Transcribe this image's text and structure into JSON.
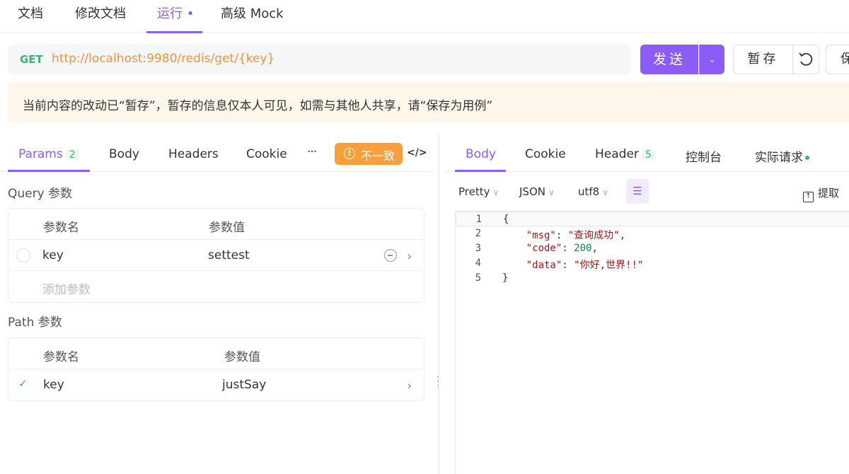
{
  "top_tabs": [
    {
      "label": "文档"
    },
    {
      "label": "修改文档"
    },
    {
      "label": "运行 •"
    },
    {
      "label": "高级 Mock"
    }
  ],
  "request": {
    "method": "GET",
    "url": "http://localhost:9980/redis/get/{key}",
    "send_label": "发送",
    "stash_label": "暂存",
    "save_label": "保"
  },
  "notice": "当前内容的改动已“暂存”，暂存的信息仅本人可见，如需与其他人共享，请“保存为用例”",
  "left_tabs": {
    "params": "Params",
    "params_count": "2",
    "body": "Body",
    "headers": "Headers",
    "cookies": "Cookie",
    "more": "···",
    "mismatch": "不一致",
    "code": "</>"
  },
  "query": {
    "title": "Query 参数",
    "col_name": "参数名",
    "col_value": "参数值",
    "rows": [
      {
        "name": "key",
        "value": "settest"
      }
    ],
    "add_placeholder": "添加参数"
  },
  "path": {
    "title": "Path 参数",
    "col_name": "参数名",
    "col_value": "参数值",
    "rows": [
      {
        "name": "key",
        "value": "justSay"
      }
    ]
  },
  "right_tabs": {
    "body": "Body",
    "cookie": "Cookie",
    "header": "Header",
    "header_count": "5",
    "console": "控制台",
    "actual": "实际请求"
  },
  "response_toolbar": {
    "format": "Pretty",
    "type": "JSON",
    "encoding": "utf8",
    "extract": "提取"
  },
  "response_lines": [
    {
      "n": "1",
      "text": "{"
    },
    {
      "n": "2",
      "key": "\"msg\"",
      "val": "\"查询成功\"",
      "tail": ","
    },
    {
      "n": "3",
      "key": "\"code\"",
      "num": "200",
      "tail": ","
    },
    {
      "n": "4",
      "key": "\"data\"",
      "val": "\"你好,世界!!\"",
      "tail": ""
    },
    {
      "n": "5",
      "text": "}"
    }
  ],
  "colors": {
    "accent": "#8b5cf6",
    "get_method": "#3cb371",
    "url": "#f0943a",
    "warning": "#f5a03c",
    "notice_bg": "#fff6ec"
  }
}
